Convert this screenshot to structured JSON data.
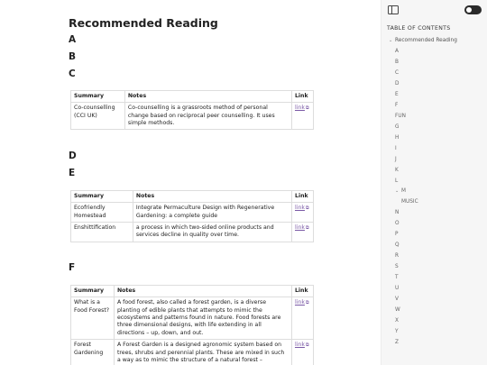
{
  "main": {
    "title": "Recommended Reading",
    "headings": {
      "A": "A",
      "B": "B",
      "C": "C",
      "D": "D",
      "E": "E",
      "F": "F"
    },
    "table_headers": {
      "summary": "Summary",
      "notes": "Notes",
      "link": "Link"
    },
    "sections": {
      "C": [
        {
          "summary": "Co-counselling (CCI UK)",
          "notes": "Co-counselling is a grassroots method of personal change based on reciprocal peer counselling. It uses simple methods.",
          "link": "link"
        }
      ],
      "E": [
        {
          "summary": "Ecofriendly Homestead",
          "notes": "Integrate Permaculture Design with Regenerative Gardening: a complete guide",
          "link": "link"
        },
        {
          "summary": "Enshittification",
          "notes": "a process in which two-sided online products and services decline in quality over time.",
          "link": "link"
        }
      ],
      "F": [
        {
          "summary": "What is a Food Forest?",
          "notes": "A food forest, also called a forest garden, is a diverse planting of edible plants that attempts to mimic the ecosystems and patterns found in nature. Food forests are three dimensional designs, with life extending in all directions – up, down, and out.",
          "link": "link"
        },
        {
          "summary": "Forest Gardening",
          "notes": "A Forest Garden is a designed agronomic system based on trees, shrubs and perennial plants. These are mixed in such a way as to mimic the structure of a natural forest –",
          "link": "link"
        }
      ]
    }
  },
  "sidebar": {
    "toc_title": "TABLE OF CONTENTS",
    "root": "Recommended Reading",
    "letters": [
      "A",
      "B",
      "C",
      "D",
      "E",
      "F",
      "FUN",
      "G",
      "H",
      "I",
      "J",
      "K",
      "L"
    ],
    "m": "M",
    "music": "MUSIC",
    "letters2": [
      "N",
      "O",
      "P",
      "Q",
      "R",
      "S",
      "T",
      "U",
      "V",
      "W",
      "X",
      "Y",
      "Z"
    ]
  }
}
